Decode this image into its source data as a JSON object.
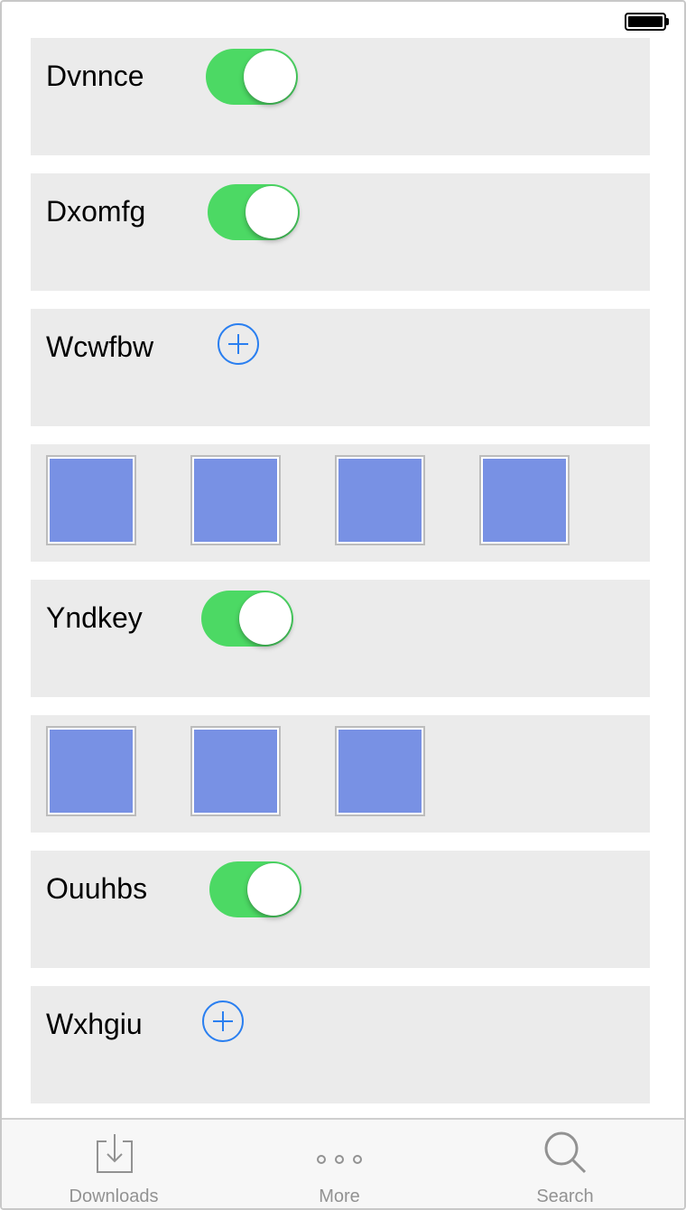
{
  "status_bar": {
    "battery_icon": "battery-full-icon"
  },
  "cells": [
    {
      "type": "toggle",
      "label": "Dvnnce",
      "on": true
    },
    {
      "type": "toggle",
      "label": "Dxomfg",
      "on": true
    },
    {
      "type": "add",
      "label": "Wcwfbw",
      "icon": "plus-circle-icon"
    },
    {
      "type": "images",
      "count": 4
    },
    {
      "type": "toggle",
      "label": "Yndkey",
      "on": true
    },
    {
      "type": "images",
      "count": 3
    },
    {
      "type": "toggle",
      "label": "Ouuhbs",
      "on": true
    },
    {
      "type": "add",
      "label": "Wxhgiu",
      "icon": "plus-circle-icon"
    }
  ],
  "colors": {
    "toggle_on": "#4cd964",
    "accent": "#2a7ff0",
    "thumbnail": "#7891e4",
    "cell_background": "#ebebeb"
  },
  "tab_bar": {
    "tabs": [
      {
        "label": "Downloads",
        "icon": "downloads-icon"
      },
      {
        "label": "More",
        "icon": "more-icon"
      },
      {
        "label": "Search",
        "icon": "search-icon"
      }
    ]
  }
}
